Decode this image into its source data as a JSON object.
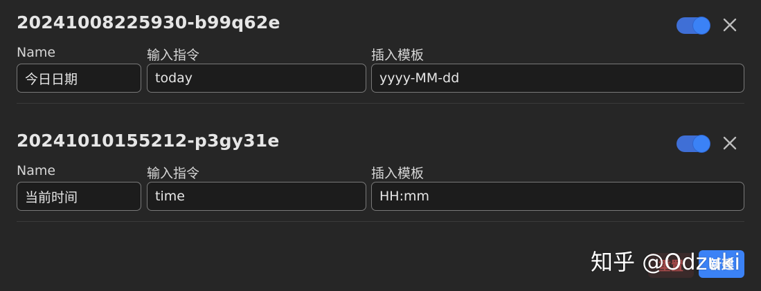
{
  "snippets": [
    {
      "id": "20241008225930-b99q62e",
      "enabled": true,
      "name_label": "Name",
      "command_label": "输入指令",
      "template_label": "插入模板",
      "name_value": "今日日期",
      "command_value": "today",
      "template_value": "yyyy-MM-dd"
    },
    {
      "id": "20241010155212-p3gy31e",
      "enabled": true,
      "name_label": "Name",
      "command_label": "输入指令",
      "template_label": "插入模板",
      "name_value": "当前时间",
      "command_value": "time",
      "template_value": "HH:mm"
    }
  ],
  "actions": {
    "reset_label": "重置",
    "new_label": "新建"
  },
  "watermark": "知乎 @Odzuki",
  "colors": {
    "background": "#262626",
    "accent": "#3b82f6",
    "danger": "#a84a4a"
  }
}
